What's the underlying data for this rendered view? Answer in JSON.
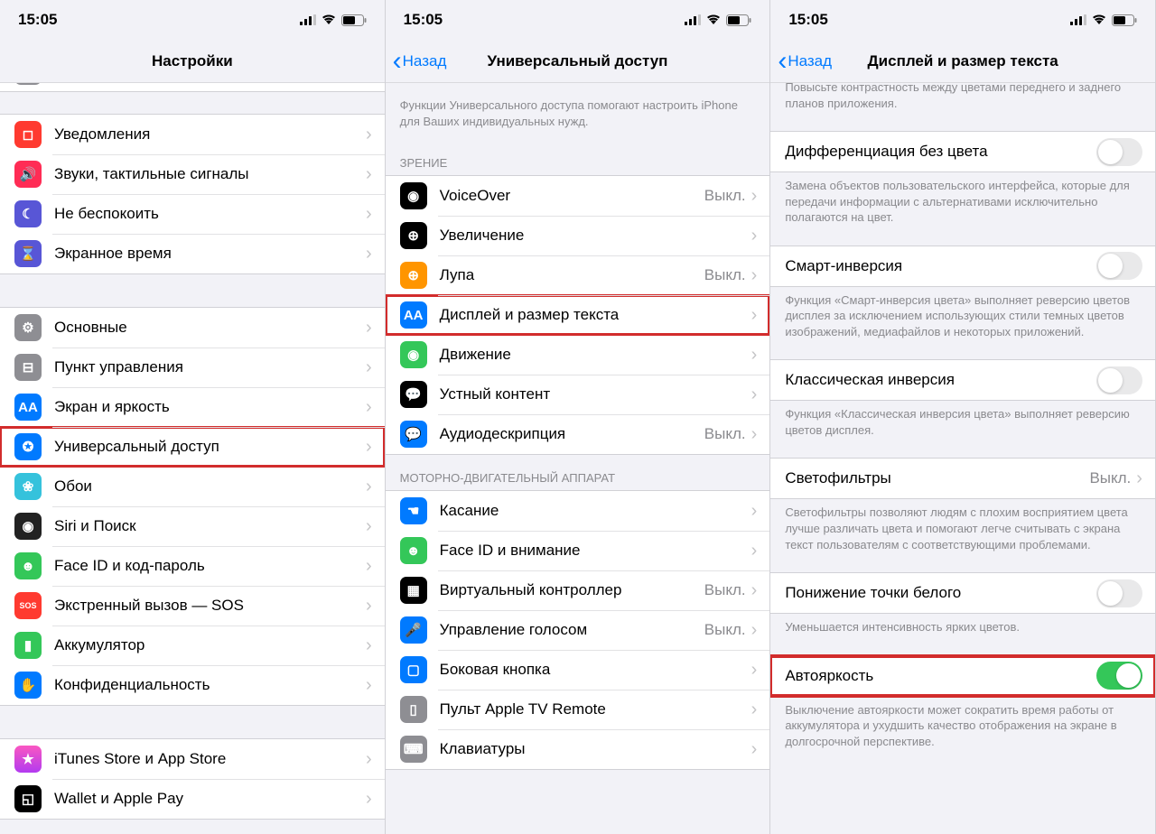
{
  "status": {
    "time": "15:05"
  },
  "panel1": {
    "title": "Настройки",
    "rows_g1": [
      {
        "label": "Уведомления",
        "icon_bg": "#ff3a30",
        "glyph": "◻︎"
      },
      {
        "label": "Звуки, тактильные сигналы",
        "icon_bg": "#ff2c55",
        "glyph": "🔊"
      },
      {
        "label": "Не беспокоить",
        "icon_bg": "#5856d6",
        "glyph": "☾"
      },
      {
        "label": "Экранное время",
        "icon_bg": "#5856d6",
        "glyph": "⌛"
      }
    ],
    "rows_g2": [
      {
        "label": "Основные",
        "icon_bg": "#8e8e93",
        "glyph": "⚙"
      },
      {
        "label": "Пункт управления",
        "icon_bg": "#8e8e93",
        "glyph": "⊟"
      },
      {
        "label": "Экран и яркость",
        "icon_bg": "#007aff",
        "glyph": "AA"
      },
      {
        "label": "Универсальный доступ",
        "icon_bg": "#007aff",
        "glyph": "✪",
        "hl": true
      },
      {
        "label": "Обои",
        "icon_bg": "#35c2dc",
        "glyph": "❀"
      },
      {
        "label": "Siri и Поиск",
        "icon_bg": "#222",
        "glyph": "◉"
      },
      {
        "label": "Face ID и код-пароль",
        "icon_bg": "#34c759",
        "glyph": "☻"
      },
      {
        "label": "Экстренный вызов — SOS",
        "icon_bg": "#ff3a30",
        "glyph": "SOS"
      },
      {
        "label": "Аккумулятор",
        "icon_bg": "#34c759",
        "glyph": "▮"
      },
      {
        "label": "Конфиденциальность",
        "icon_bg": "#007aff",
        "glyph": "✋"
      }
    ],
    "rows_g3": [
      {
        "label": "iTunes Store и App Store",
        "glyph": "★"
      },
      {
        "label": "Wallet и Apple Pay",
        "icon_bg": "#000",
        "glyph": "◱"
      }
    ]
  },
  "panel2": {
    "back": "Назад",
    "title": "Универсальный доступ",
    "intro": "Функции Универсального доступа помогают настроить iPhone для Ваших индивидуальных нужд.",
    "sec_vision": "ЗРЕНИЕ",
    "vision_rows": [
      {
        "label": "VoiceOver",
        "value": "Выкл.",
        "icon_bg": "#000",
        "glyph": "◉"
      },
      {
        "label": "Увеличение",
        "icon_bg": "#000",
        "glyph": "⊕"
      },
      {
        "label": "Лупа",
        "value": "Выкл.",
        "icon_bg": "#ff9500",
        "glyph": "⊕"
      },
      {
        "label": "Дисплей и размер текста",
        "icon_bg": "#007aff",
        "glyph": "AA",
        "hl": true
      },
      {
        "label": "Движение",
        "icon_bg": "#34c759",
        "glyph": "◉"
      },
      {
        "label": "Устный контент",
        "icon_bg": "#000",
        "glyph": "💬"
      },
      {
        "label": "Аудиодескрипция",
        "value": "Выкл.",
        "icon_bg": "#007aff",
        "glyph": "💬"
      }
    ],
    "sec_motor": "МОТОРНО-ДВИГАТЕЛЬНЫЙ АППАРАТ",
    "motor_rows": [
      {
        "label": "Касание",
        "icon_bg": "#007aff",
        "glyph": "☚"
      },
      {
        "label": "Face ID и внимание",
        "icon_bg": "#34c759",
        "glyph": "☻"
      },
      {
        "label": "Виртуальный контроллер",
        "value": "Выкл.",
        "icon_bg": "#000",
        "glyph": "▦"
      },
      {
        "label": "Управление голосом",
        "value": "Выкл.",
        "icon_bg": "#007aff",
        "glyph": "🎤"
      },
      {
        "label": "Боковая кнопка",
        "icon_bg": "#007aff",
        "glyph": "▢"
      },
      {
        "label": "Пульт Apple TV Remote",
        "icon_bg": "#8e8e93",
        "glyph": "▯"
      },
      {
        "label": "Клавиатуры",
        "icon_bg": "#8e8e93",
        "glyph": "⌨"
      }
    ]
  },
  "panel3": {
    "back": "Назад",
    "title": "Дисплей и размер текста",
    "pre_footer": "Повысьте контрастность между цветами переднего и заднего планов приложения.",
    "rows": [
      {
        "label": "Дифференциация без цвета",
        "toggle": false,
        "footer": "Замена объектов пользовательского интерфейса, которые для передачи информации с альтернативами исключительно полагаются на цвет."
      },
      {
        "label": "Смарт-инверсия",
        "toggle": false,
        "footer": "Функция «Смарт-инверсия цвета» выполняет реверсию цветов дисплея за исключением использующих стили темных цветов изображений, медиафайлов и некоторых приложений."
      },
      {
        "label": "Классическая инверсия",
        "toggle": false,
        "footer": "Функция «Классическая инверсия цвета» выполняет реверсию цветов дисплея."
      },
      {
        "label": "Светофильтры",
        "value": "Выкл.",
        "footer": "Светофильтры позволяют людям с плохим восприятием цвета лучше различать цвета и помогают легче считывать с экрана текст пользователям с соответствующими проблемами."
      },
      {
        "label": "Понижение точки белого",
        "toggle": false,
        "footer": "Уменьшается интенсивность ярких цветов."
      },
      {
        "label": "Автояркость",
        "toggle": true,
        "hl": true,
        "footer": "Выключение автояркости может сократить время работы от аккумулятора и ухудшить качество отображения на экране в долгосрочной перспективе."
      }
    ]
  }
}
